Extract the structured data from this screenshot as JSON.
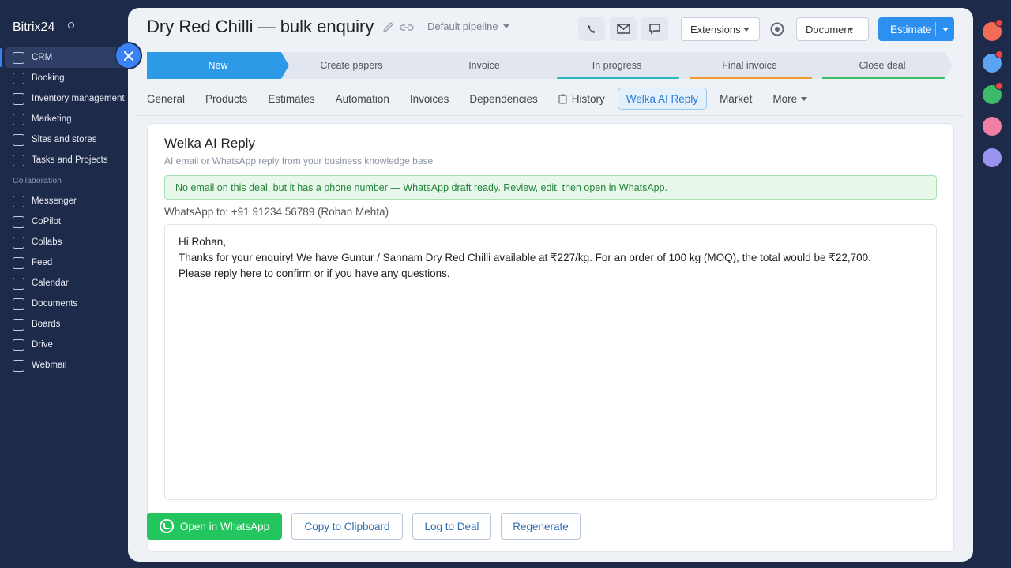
{
  "app": {
    "brand": "Bitrix24"
  },
  "sidebar": {
    "items": [
      {
        "label": "CRM",
        "active": true
      },
      {
        "label": "Booking"
      },
      {
        "label": "Inventory management"
      },
      {
        "label": "Marketing"
      },
      {
        "label": "Sites and stores"
      },
      {
        "label": "Tasks and Projects"
      }
    ],
    "section_label": "Collaboration",
    "items2": [
      {
        "label": "Messenger"
      },
      {
        "label": "CoPilot"
      },
      {
        "label": "Collabs"
      },
      {
        "label": "Feed"
      },
      {
        "label": "Calendar"
      },
      {
        "label": "Documents"
      },
      {
        "label": "Boards"
      },
      {
        "label": "Drive"
      },
      {
        "label": "Webmail"
      }
    ]
  },
  "header": {
    "title": "Dry Red Chilli — bulk enquiry",
    "pipeline": "Default pipeline",
    "extensions_label": "Extensions",
    "document_label": "Document",
    "estimate_label": "Estimate"
  },
  "stages": [
    {
      "label": "New",
      "active": true
    },
    {
      "label": "Create papers"
    },
    {
      "label": "Invoice"
    },
    {
      "label": "In progress",
      "bar_color": "#2bb7c4"
    },
    {
      "label": "Final invoice",
      "bar_color": "#f39a2c"
    },
    {
      "label": "Close deal",
      "bar_color": "#3cbb6a"
    }
  ],
  "tabs": [
    {
      "label": "General"
    },
    {
      "label": "Products"
    },
    {
      "label": "Estimates"
    },
    {
      "label": "Automation"
    },
    {
      "label": "Invoices"
    },
    {
      "label": "Dependencies"
    },
    {
      "label": "History"
    },
    {
      "label": "Welka AI Reply",
      "active": true
    },
    {
      "label": "Market"
    },
    {
      "label": "More"
    }
  ],
  "panel": {
    "title": "Welka AI Reply",
    "subtitle": "AI email or WhatsApp reply from your business knowledge base",
    "notice": "No email on this deal, but it has a phone number — WhatsApp draft ready. Review, edit, then open in WhatsApp.",
    "to_line": "WhatsApp to: +91 91234 56789 (Rohan Mehta)",
    "message_lines": [
      "Hi Rohan,",
      "Thanks for your enquiry! We have Guntur / Sannam Dry Red Chilli available at ₹227/kg. For an order of 100 kg (MOQ), the total would be ₹22,700.",
      "Please reply here to confirm or if you have any questions."
    ]
  },
  "actions": {
    "open_whatsapp": "Open in WhatsApp",
    "copy": "Copy to Clipboard",
    "log": "Log to Deal",
    "regenerate": "Regenerate"
  },
  "colors": {
    "accent": "#2d8ff0",
    "sidebar_bg": "#1e2a4a",
    "whatsapp_green": "#22c55e"
  }
}
